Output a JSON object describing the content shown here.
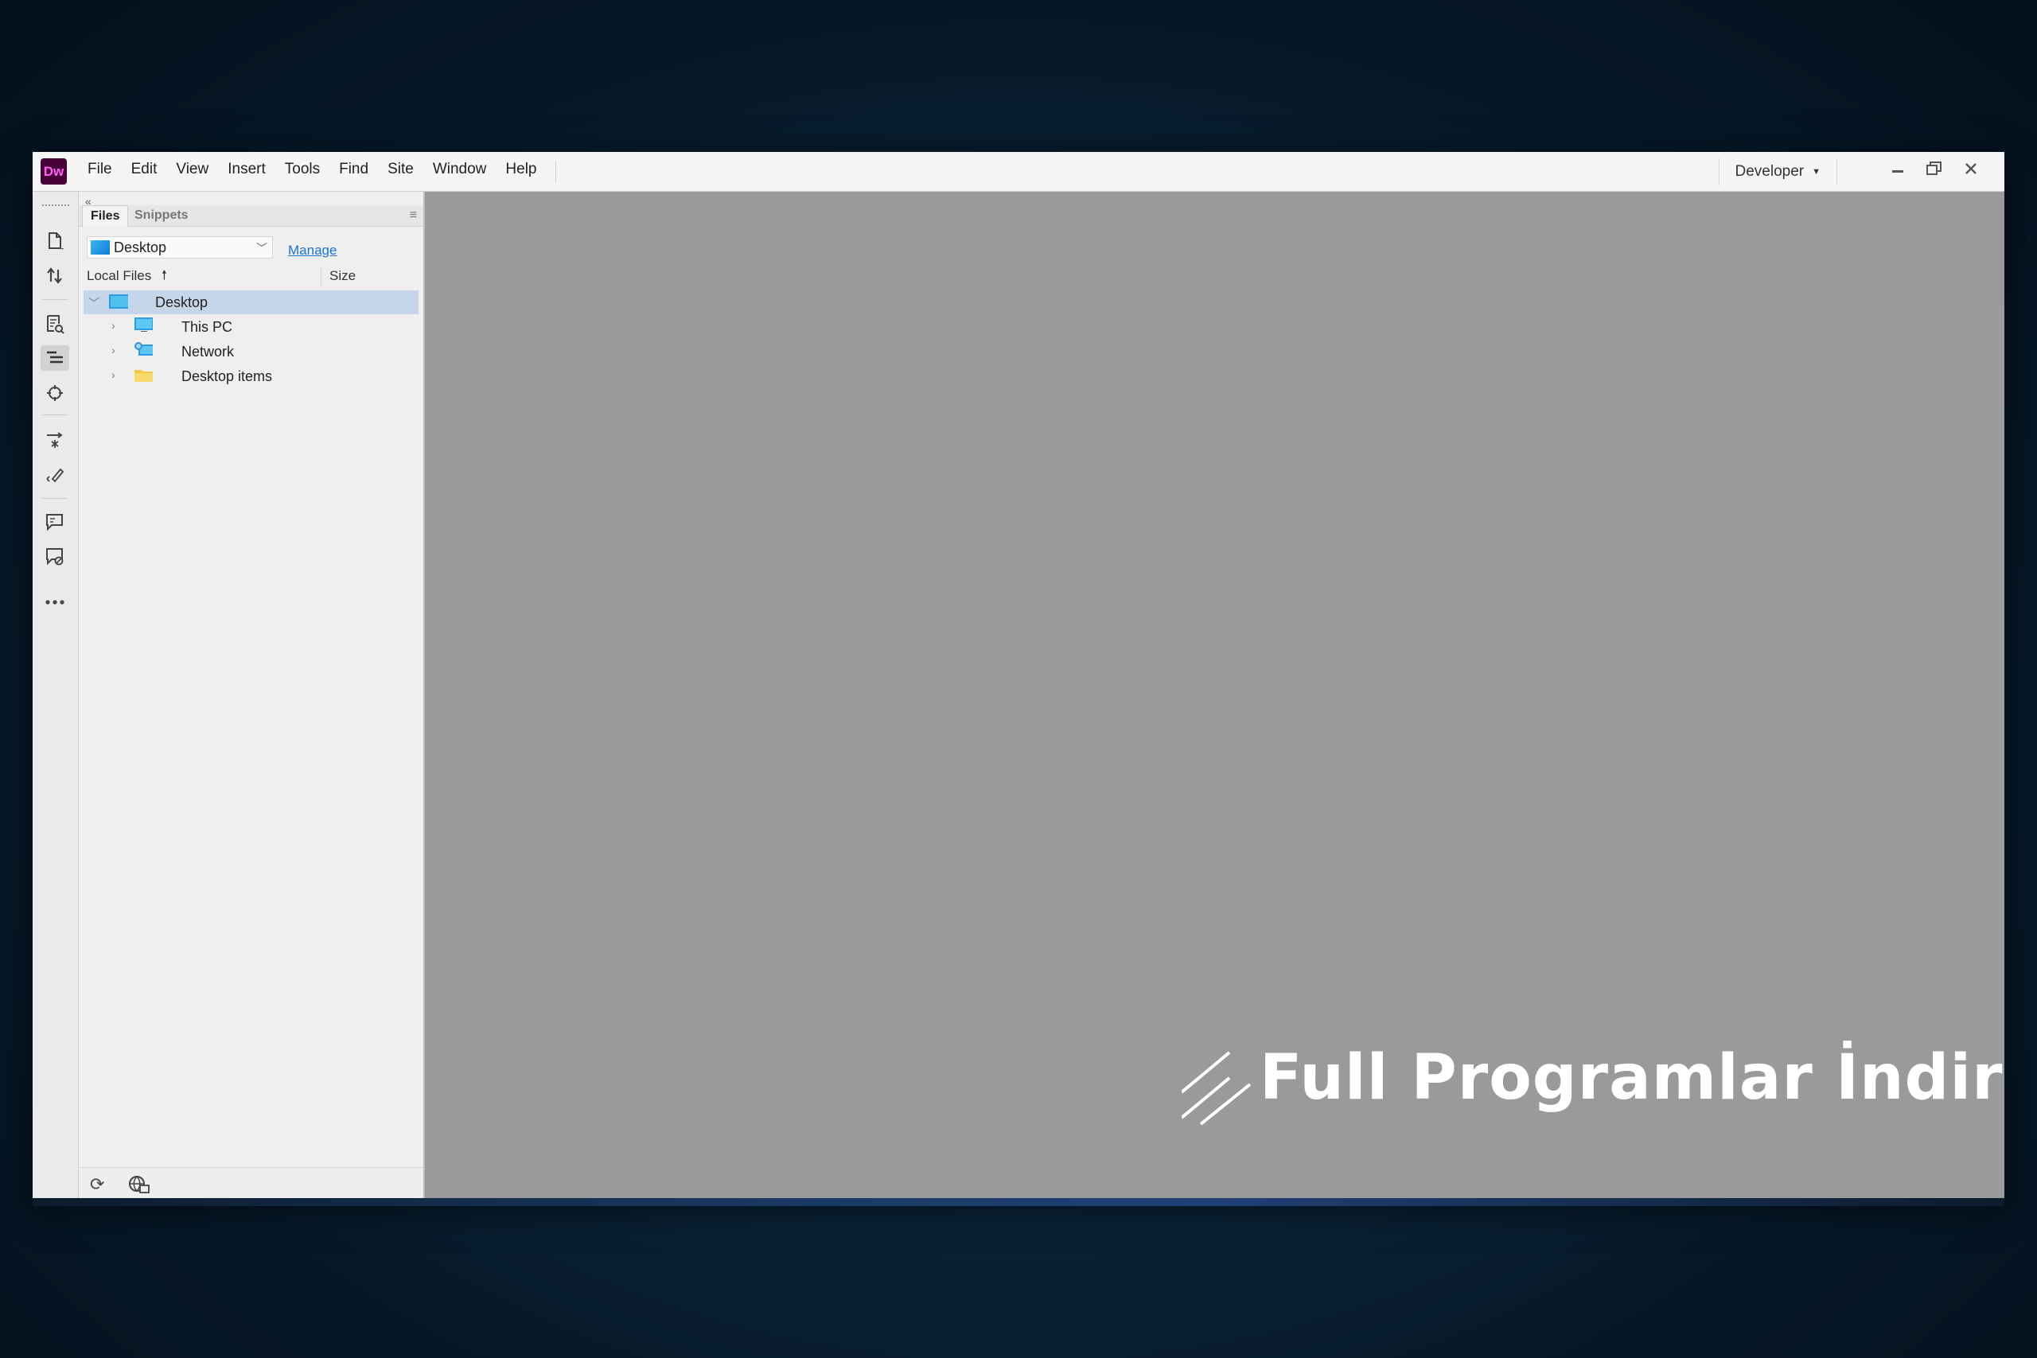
{
  "app": {
    "logo_text": "Dw",
    "menu": [
      "File",
      "Edit",
      "View",
      "Insert",
      "Tools",
      "Find",
      "Site",
      "Window",
      "Help"
    ],
    "workspace": "Developer"
  },
  "panel": {
    "tabs": [
      "Files",
      "Snippets"
    ],
    "active_tab": "Files",
    "site_select": "Desktop",
    "manage_label": "Manage",
    "columns": {
      "local": "Local Files",
      "size": "Size"
    },
    "tree": [
      {
        "label": "Desktop",
        "level": 0,
        "expanded": true,
        "selected": true,
        "icon": "desktop-icon"
      },
      {
        "label": "This PC",
        "level": 1,
        "expanded": false,
        "icon": "computer-icon"
      },
      {
        "label": "Network",
        "level": 1,
        "expanded": false,
        "icon": "network-icon"
      },
      {
        "label": "Desktop items",
        "level": 1,
        "expanded": false,
        "icon": "folder-icon"
      }
    ]
  },
  "toolbar_icons": [
    "open-document-icon",
    "file-transfer-icon",
    "live-view-icon",
    "code-navigator-icon",
    "target-icon",
    "expand-all-icon",
    "format-source-icon",
    "comment-icon",
    "remove-comment-icon",
    "more-options-icon"
  ],
  "watermark": {
    "text": "Full Programlar İndir"
  },
  "colors": {
    "accent": "#1a73d6",
    "logo_bg": "#470137",
    "logo_fg": "#ff61f6",
    "selection": "#c6d6ea",
    "document_bg": "#9a9a9a"
  }
}
